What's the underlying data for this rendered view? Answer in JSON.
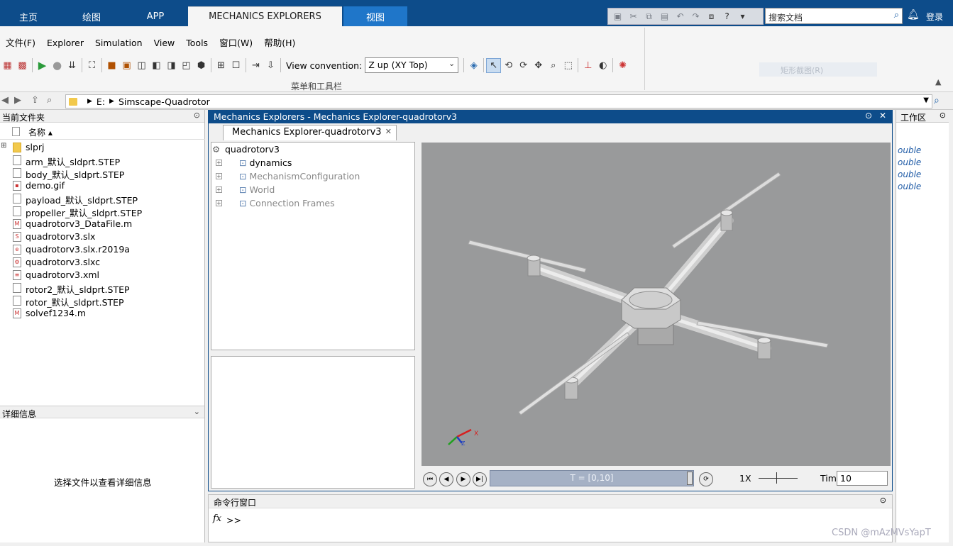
{
  "ribbon": {
    "tabs": [
      "主页",
      "绘图",
      "APP",
      "MECHANICS EXPLORERS",
      "视图"
    ],
    "search_placeholder": "搜索文档",
    "login": "登录"
  },
  "menu": [
    "文件(F)",
    "Explorer",
    "Simulation",
    "View",
    "Tools",
    "窗口(W)",
    "帮助(H)"
  ],
  "toolbar": {
    "view_convention_label": "View convention:",
    "view_convention_value": "Z up (XY Top)",
    "caption": "菜单和工具栏",
    "ghost_button": "矩形截图(R)"
  },
  "address": {
    "drive": "E:",
    "folder": "Simscape-Quadrotor"
  },
  "current_folder": {
    "title": "当前文件夹",
    "column_name": "名称",
    "files": [
      {
        "name": "slprj",
        "kind": "folder"
      },
      {
        "name": "arm_默认_sldprt.STEP",
        "kind": "file"
      },
      {
        "name": "body_默认_sldprt.STEP",
        "kind": "file"
      },
      {
        "name": "demo.gif",
        "kind": "image"
      },
      {
        "name": "payload_默认_sldprt.STEP",
        "kind": "file"
      },
      {
        "name": "propeller_默认_sldprt.STEP",
        "kind": "file"
      },
      {
        "name": "quadrotorv3_DataFile.m",
        "kind": "mfile"
      },
      {
        "name": "quadrotorv3.slx",
        "kind": "slx"
      },
      {
        "name": "quadrotorv3.slx.r2019a",
        "kind": "backup"
      },
      {
        "name": "quadrotorv3.slxc",
        "kind": "slxc"
      },
      {
        "name": "quadrotorv3.xml",
        "kind": "xml"
      },
      {
        "name": "rotor2_默认_sldprt.STEP",
        "kind": "file"
      },
      {
        "name": "rotor_默认_sldprt.STEP",
        "kind": "file"
      },
      {
        "name": "solvef1234.m",
        "kind": "mfile"
      }
    ]
  },
  "details": {
    "title": "详细信息",
    "message": "选择文件以查看详细信息"
  },
  "mechanics": {
    "window_title": "Mechanics Explorers - Mechanics Explorer-quadrotorv3",
    "tab_label": "Mechanics Explorer-quadrotorv3",
    "tree": [
      {
        "label": "quadrotorv3",
        "level": 0,
        "gray": false
      },
      {
        "label": "dynamics",
        "level": 1,
        "gray": false
      },
      {
        "label": "MechanismConfiguration",
        "level": 1,
        "gray": true
      },
      {
        "label": "World",
        "level": 1,
        "gray": true
      },
      {
        "label": "Connection Frames",
        "level": 1,
        "gray": true
      }
    ],
    "time_range": "T = [0,10]",
    "speed": "1X",
    "time_label": "Time",
    "time_value": "10",
    "axis_x": "X",
    "axis_z": "Z"
  },
  "command": {
    "title": "命令行窗口",
    "fx": "fx",
    "prompt": ">>"
  },
  "workspace": {
    "title": "工作区",
    "values": [
      "ouble",
      "ouble",
      "ouble",
      "ouble"
    ]
  },
  "watermark": "CSDN @mAzMVsYapT"
}
